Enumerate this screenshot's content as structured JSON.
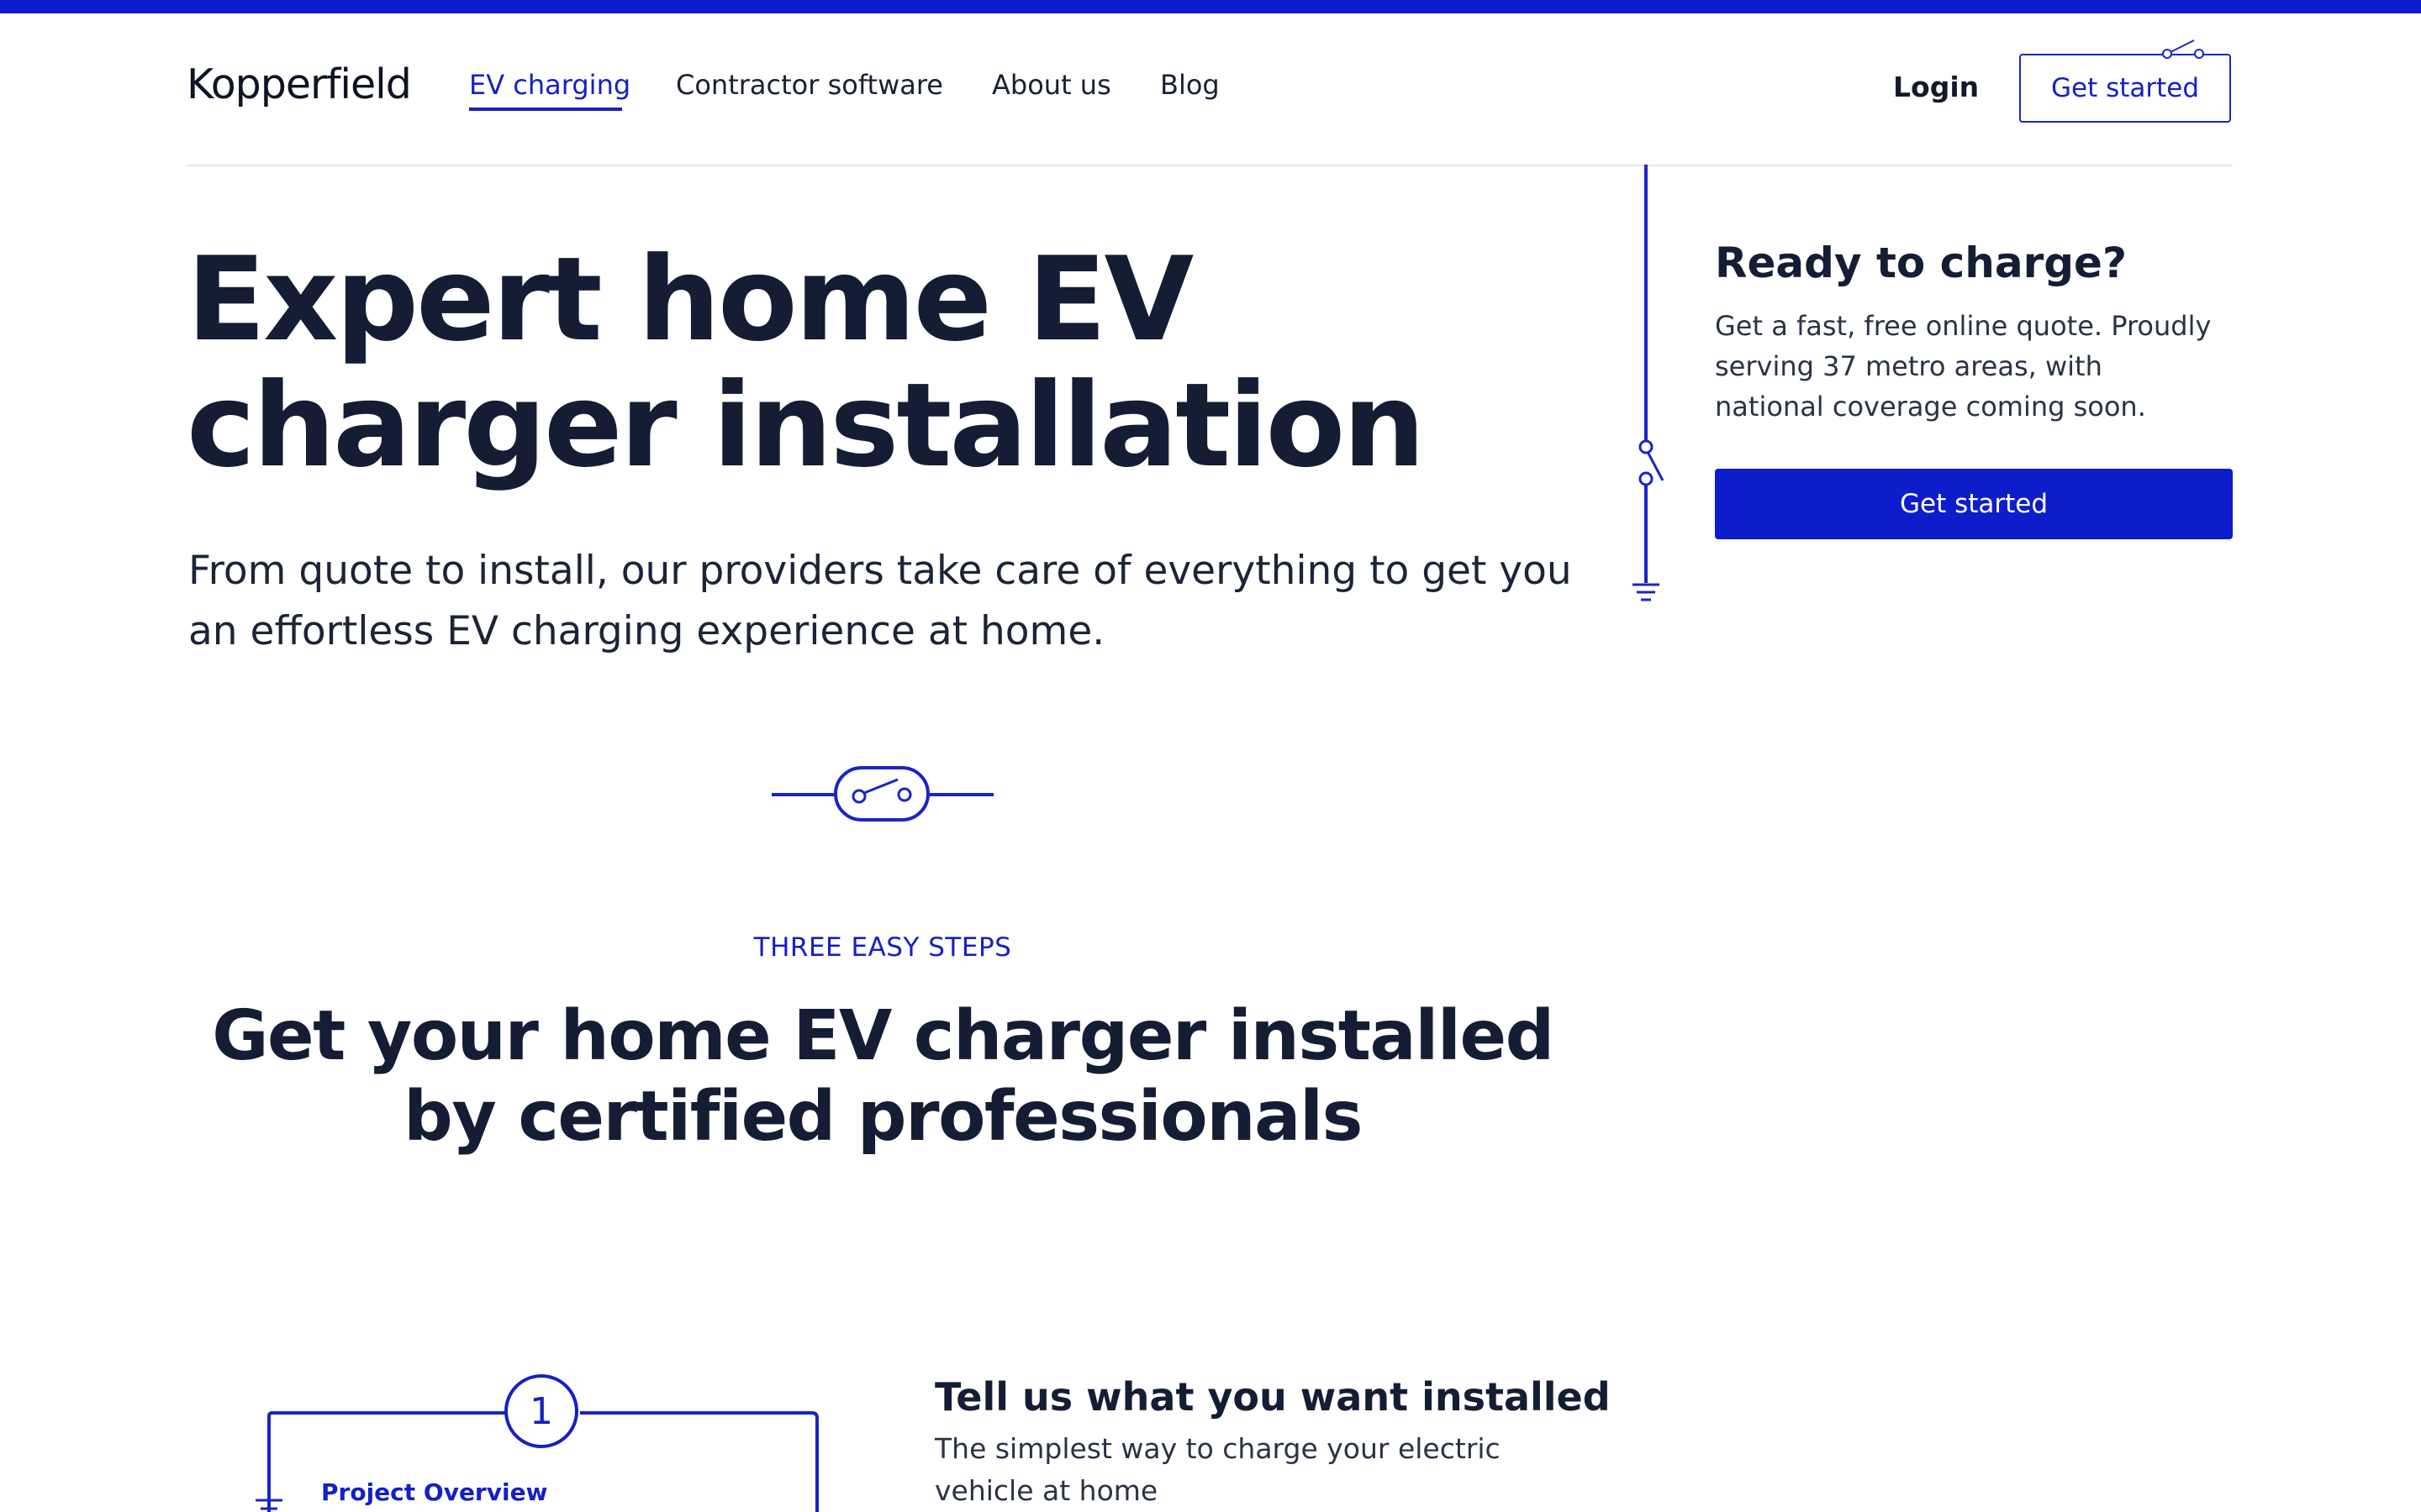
{
  "header": {
    "logo": "Kopperfield",
    "nav": [
      "EV charging",
      "Contractor software",
      "About us",
      "Blog"
    ],
    "login": "Login",
    "get_started": "Get started"
  },
  "hero": {
    "title": "Expert home EV charger installation",
    "subtitle": "From quote to install, our providers take care of everything to get you an effortless EV charging experience at home."
  },
  "card": {
    "title": "Ready to charge?",
    "text": "Get a fast, free online quote. Proudly serving 37 metro areas, with national coverage coming soon.",
    "button": "Get started"
  },
  "steps_section": {
    "eyebrow": "THREE EASY STEPS",
    "title": "Get your home EV charger installed by certified professionals",
    "step1": {
      "number": "1",
      "label": "Project Overview",
      "title": "Tell us what you want installed",
      "text": "The simplest way to charge your electric vehicle at home"
    }
  },
  "colors": {
    "accent": "#0d1dcc",
    "text": "#141d33",
    "divider": "#e2e5ec"
  }
}
